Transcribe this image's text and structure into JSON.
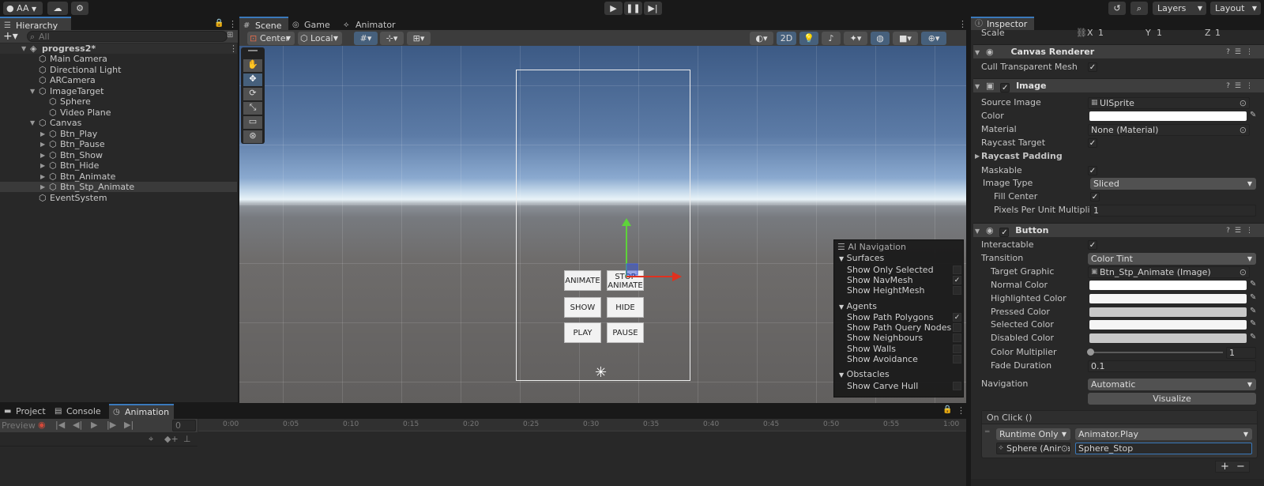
{
  "toolbar": {
    "account": "AA",
    "layers": "Layers",
    "layout": "Layout",
    "icons": {
      "account": "account-icon",
      "cloud": "cloud-icon",
      "services": "services-icon",
      "play": "play-icon",
      "pause": "pause-icon",
      "step": "step-icon",
      "history": "history-icon",
      "search": "search-icon"
    }
  },
  "hierarchy": {
    "tab": "Hierarchy",
    "search_placeholder": "All",
    "scene_name": "progress2*",
    "items": [
      {
        "label": "Main Camera",
        "depth": 1,
        "fold": ""
      },
      {
        "label": "Directional Light",
        "depth": 1,
        "fold": ""
      },
      {
        "label": "ARCamera",
        "depth": 1,
        "fold": ""
      },
      {
        "label": "ImageTarget",
        "depth": 1,
        "fold": "▼"
      },
      {
        "label": "Sphere",
        "depth": 2,
        "fold": ""
      },
      {
        "label": "Video Plane",
        "depth": 2,
        "fold": ""
      },
      {
        "label": "Canvas",
        "depth": 1,
        "fold": "▼"
      },
      {
        "label": "Btn_Play",
        "depth": 2,
        "fold": "▶"
      },
      {
        "label": "Btn_Pause",
        "depth": 2,
        "fold": "▶"
      },
      {
        "label": "Btn_Show",
        "depth": 2,
        "fold": "▶"
      },
      {
        "label": "Btn_Hide",
        "depth": 2,
        "fold": "▶"
      },
      {
        "label": "Btn_Animate",
        "depth": 2,
        "fold": "▶"
      },
      {
        "label": "Btn_Stp_Animate",
        "depth": 2,
        "fold": "▶",
        "selected": true
      },
      {
        "label": "EventSystem",
        "depth": 1,
        "fold": ""
      }
    ]
  },
  "scene": {
    "tabs": [
      "Scene",
      "Game",
      "Animator"
    ],
    "pivot": "Center",
    "space": "Local",
    "mode_2d": "2D",
    "buttons": {
      "animate": "ANIMATE",
      "stop_animate_1": "STOP",
      "stop_animate_2": "ANIMATE",
      "show": "SHOW",
      "hide": "HIDE",
      "play": "PLAY",
      "pause": "PAUSE"
    },
    "ai_navigation": {
      "title": "AI Navigation",
      "surfaces": "Surfaces",
      "surfaces_items": [
        {
          "label": "Show Only Selected",
          "checked": false
        },
        {
          "label": "Show NavMesh",
          "checked": true
        },
        {
          "label": "Show HeightMesh",
          "checked": false
        }
      ],
      "agents": "Agents",
      "agents_items": [
        {
          "label": "Show Path Polygons",
          "checked": true
        },
        {
          "label": "Show Path Query Nodes",
          "checked": false
        },
        {
          "label": "Show Neighbours",
          "checked": false
        },
        {
          "label": "Show Walls",
          "checked": false
        },
        {
          "label": "Show Avoidance",
          "checked": false
        }
      ],
      "obstacles": "Obstacles",
      "obstacles_items": [
        {
          "label": "Show Carve Hull",
          "checked": false
        }
      ]
    }
  },
  "bottom": {
    "tabs": [
      "Project",
      "Console",
      "Animation"
    ],
    "preview": "Preview",
    "frame": "0",
    "ticks": [
      "0:00",
      "0:05",
      "0:10",
      "0:15",
      "0:20",
      "0:25",
      "0:30",
      "0:35",
      "0:40",
      "0:45",
      "0:50",
      "0:55",
      "1:00"
    ]
  },
  "inspector": {
    "tab": "Inspector",
    "scale_label": "Scale",
    "scale": {
      "x": "1",
      "y": "1",
      "z": "1"
    },
    "canvas_renderer": "Canvas Renderer",
    "cull_transparent": "Cull Transparent Mesh",
    "image": "Image",
    "source_image_label": "Source Image",
    "source_image": "UISprite",
    "color_label": "Color",
    "material_label": "Material",
    "material": "None (Material)",
    "raycast_target": "Raycast Target",
    "raycast_padding": "Raycast Padding",
    "maskable": "Maskable",
    "image_type_label": "Image Type",
    "image_type": "Sliced",
    "fill_center": "Fill Center",
    "ppu_label": "Pixels Per Unit Multiplier",
    "ppu": "1",
    "button": "Button",
    "interactable": "Interactable",
    "transition_label": "Transition",
    "transition": "Color Tint",
    "target_graphic_label": "Target Graphic",
    "target_graphic": "Btn_Stp_Animate (Image)",
    "colors": [
      {
        "label": "Normal Color",
        "hex": "#ffffff"
      },
      {
        "label": "Highlighted Color",
        "hex": "#f5f5f5"
      },
      {
        "label": "Pressed Color",
        "hex": "#c8c8c8"
      },
      {
        "label": "Selected Color",
        "hex": "#f5f5f5"
      },
      {
        "label": "Disabled Color",
        "hex": "#c8c8c8"
      }
    ],
    "color_multiplier_label": "Color Multiplier",
    "color_multiplier": "1",
    "fade_duration_label": "Fade Duration",
    "fade_duration": "0.1",
    "navigation_label": "Navigation",
    "navigation": "Automatic",
    "visualize": "Visualize",
    "onclick": "On Click ()",
    "runtime": "Runtime Only",
    "function": "Animator.Play",
    "target_obj": "Sphere (Anima",
    "arg": "Sphere_Stop",
    "plus": "+",
    "minus": "−"
  }
}
